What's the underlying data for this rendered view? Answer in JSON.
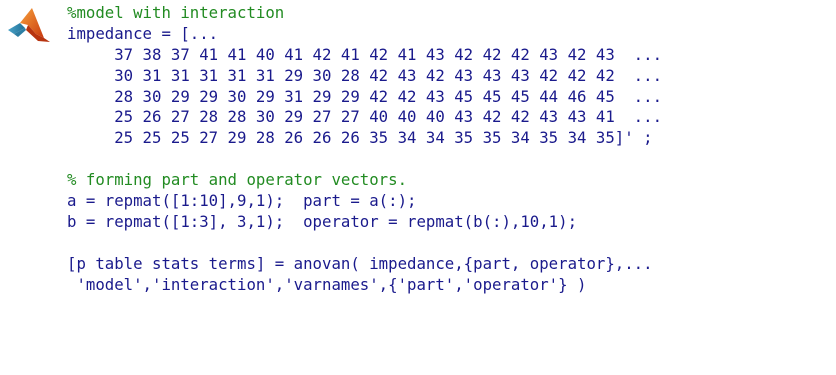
{
  "code": {
    "lines": [
      {
        "kind": "comment",
        "text": "%model with interaction"
      },
      {
        "kind": "code",
        "text": "impedance = [..."
      },
      {
        "kind": "code",
        "text": "     37 38 37 41 41 40 41 42 41 42 41 43 42 42 42 43 42 43  ..."
      },
      {
        "kind": "code",
        "text": "     30 31 31 31 31 31 29 30 28 42 43 42 43 43 43 42 42 42  ..."
      },
      {
        "kind": "code",
        "text": "     28 30 29 29 30 29 31 29 29 42 42 43 45 45 45 44 46 45  ..."
      },
      {
        "kind": "code",
        "text": "     25 26 27 28 28 30 29 27 27 40 40 40 43 42 42 43 43 41  ..."
      },
      {
        "kind": "code",
        "text": "     25 25 25 27 29 28 26 26 26 35 34 34 35 35 34 35 34 35]' ;"
      },
      {
        "kind": "blank",
        "text": ""
      },
      {
        "kind": "comment",
        "text": "% forming part and operator vectors."
      },
      {
        "kind": "code",
        "text": "a = repmat([1:10],9,1);  part = a(:);"
      },
      {
        "kind": "code",
        "text": "b = repmat([1:3], 3,1);  operator = repmat(b(:),10,1);"
      },
      {
        "kind": "blank",
        "text": ""
      },
      {
        "kind": "code",
        "text": "[p table stats terms] = anovan( impedance,{part, operator},..."
      },
      {
        "kind": "code",
        "text": " 'model','interaction','varnames',{'part','operator'} )"
      }
    ]
  },
  "colors": {
    "code_text": "#1a1a8c",
    "comment_text": "#228b22",
    "background": "#ffffff"
  },
  "icons": {
    "logo": "matlab-membrane-logo"
  }
}
